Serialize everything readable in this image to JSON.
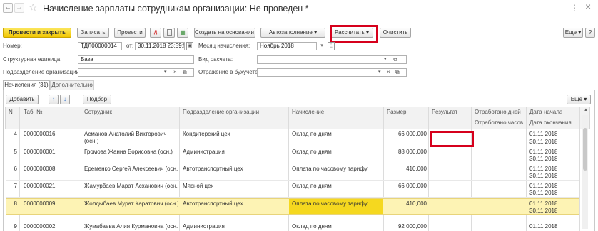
{
  "title": "Начисление зарплаты сотрудникам организации: Не проведен *",
  "nav": {
    "back": "←",
    "forward": "→",
    "star": "☆",
    "menu": "⋮",
    "close": "×"
  },
  "toolbar": {
    "post_close": "Провести и закрыть",
    "save": "Записать",
    "post": "Провести",
    "create_based": "Создать на основании",
    "autofill": "Автозаполнение",
    "calculate": "Рассчитать",
    "clear": "Очистить",
    "more": "Еще",
    "help": "?"
  },
  "form": {
    "number_label": "Номер:",
    "number_value": "ТДЛ00000014",
    "from_label": "от:",
    "date_value": "30.11.2018 23:59:5",
    "month_label": "Месяц начисления:",
    "month_value": "Ноябрь 2018",
    "struct_label": "Структурная единица:",
    "struct_value": "База",
    "calc_type_label": "Вид расчета:",
    "calc_type_value": "",
    "dept_label": "Подразделение организации:",
    "dept_value": "",
    "acct_label": "Отражение в бухучете:",
    "acct_value": ""
  },
  "tabs": [
    {
      "label": "Начисления (31)"
    },
    {
      "label": "Дополнительно"
    }
  ],
  "table_toolbar": {
    "add": "Добавить",
    "select": "Подбор",
    "more": "Еще"
  },
  "columns": {
    "n": "N",
    "tab": "Таб. №",
    "employee": "Сотрудник",
    "dept": "Подразделение организации",
    "accrual": "Начисление",
    "amount": "Размер",
    "result": "Результат",
    "worked_days": "Отработано дней",
    "worked_hours": "Отработано часов",
    "date_start": "Дата начала",
    "date_end": "Дата окончания"
  },
  "rows": [
    {
      "n": "4",
      "tab": "0000000016",
      "employee": "Асманов Анатолий Викторович",
      "employee2": "(осн.)",
      "dept": "Кондитерский цех",
      "accrual": "Оклад по дням",
      "amount": "66 000,000",
      "date_start": "01.11.2018",
      "date_end": "30.11.2018"
    },
    {
      "n": "5",
      "tab": "0000000001",
      "employee": "Громова Жанна Борисовна (осн.)",
      "employee2": "",
      "dept": "Администрация",
      "accrual": "Оклад по дням",
      "amount": "88 000,000",
      "date_start": "01.11.2018",
      "date_end": "30.11.2018"
    },
    {
      "n": "6",
      "tab": "0000000008",
      "employee": "Еременко Сергей Алексеевич (осн.)",
      "employee2": "",
      "dept": "Автотранспортный цех",
      "accrual": "Оплата по часовому тарифу",
      "amount": "410,000",
      "date_start": "01.11.2018",
      "date_end": "30.11.2018"
    },
    {
      "n": "7",
      "tab": "0000000021",
      "employee": "Жамурбаев Марат Асханович (осн.)",
      "employee2": "",
      "dept": "Мясной цех",
      "accrual": "Оклад по дням",
      "amount": "66 000,000",
      "date_start": "01.11.2018",
      "date_end": "30.11.2018"
    },
    {
      "n": "8",
      "tab": "0000000009",
      "employee": "Жолдыбаев Мурат Каратович (осн.)",
      "employee2": "",
      "dept": "Автотранспортный цех",
      "accrual": "Оплата по часовому тарифу",
      "amount": "410,000",
      "date_start": "01.11.2018",
      "date_end": "30.11.2018"
    },
    {
      "n": "9",
      "tab": "0000000002",
      "employee": "Жумабаева Алия Курмановна (осн.)",
      "employee2": "",
      "dept": "Администрация",
      "accrual": "Оклад по дням",
      "amount": "92 000,000",
      "date_start": "01.11.2018",
      "date_end": ""
    }
  ],
  "colors": {
    "accent_red": "#d6001c",
    "selected_row": "#fdf3b4",
    "selected_cell": "#f5d81f"
  }
}
